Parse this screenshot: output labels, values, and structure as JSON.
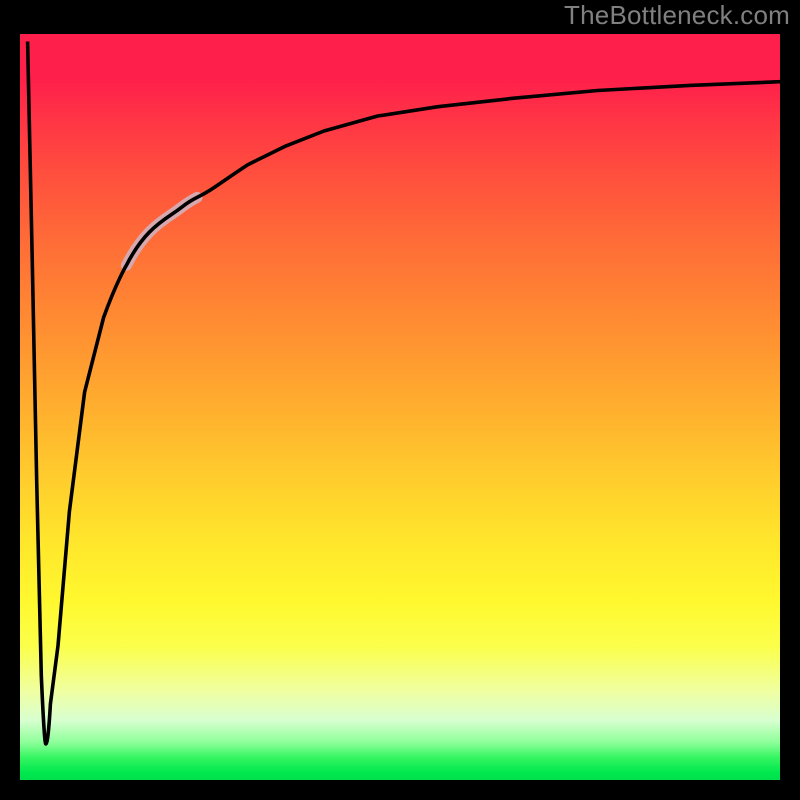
{
  "watermark": "TheBottleneck.com",
  "colors": {
    "gradient_top": "#ff1f4b",
    "gradient_mid": "#ffe62c",
    "gradient_bottom": "#00e04c",
    "frame": "#000000",
    "curve": "#000000",
    "highlight": "#d7a8ae"
  },
  "chart_data": {
    "type": "line",
    "title": "",
    "subtitle": "",
    "xlabel": "",
    "ylabel": "",
    "xlim": [
      0,
      100
    ],
    "ylim": [
      0,
      100
    ],
    "grid": false,
    "legend": false,
    "notes": "Axes are unlabeled; values estimated from position in a 100×100 normalized coordinate space. y = 0 at bottom (green), y = 100 at top (red). Curve starts at top-left, dips to near-bottom, then recovers toward top-right.",
    "series": [
      {
        "name": "curve",
        "x": [
          1.0,
          1.6,
          2.2,
          2.8,
          3.4,
          4.0,
          5.0,
          6.5,
          8.5,
          11.0,
          14.0,
          18.0,
          22.0,
          26.0,
          30.0,
          35.0,
          40.0,
          47.0,
          55.0,
          65.0,
          76.0,
          88.0,
          100.0
        ],
        "y": [
          99.0,
          70.0,
          40.0,
          14.0,
          5.0,
          5.5,
          18.0,
          36.0,
          52.0,
          62.0,
          69.0,
          74.5,
          78.0,
          80.5,
          82.5,
          85.0,
          87.0,
          88.8,
          90.2,
          91.5,
          92.4,
          93.0,
          93.6
        ]
      }
    ],
    "highlighted_segment": {
      "x": [
        14.0,
        22.0
      ],
      "y": [
        69.0,
        78.0
      ]
    }
  }
}
